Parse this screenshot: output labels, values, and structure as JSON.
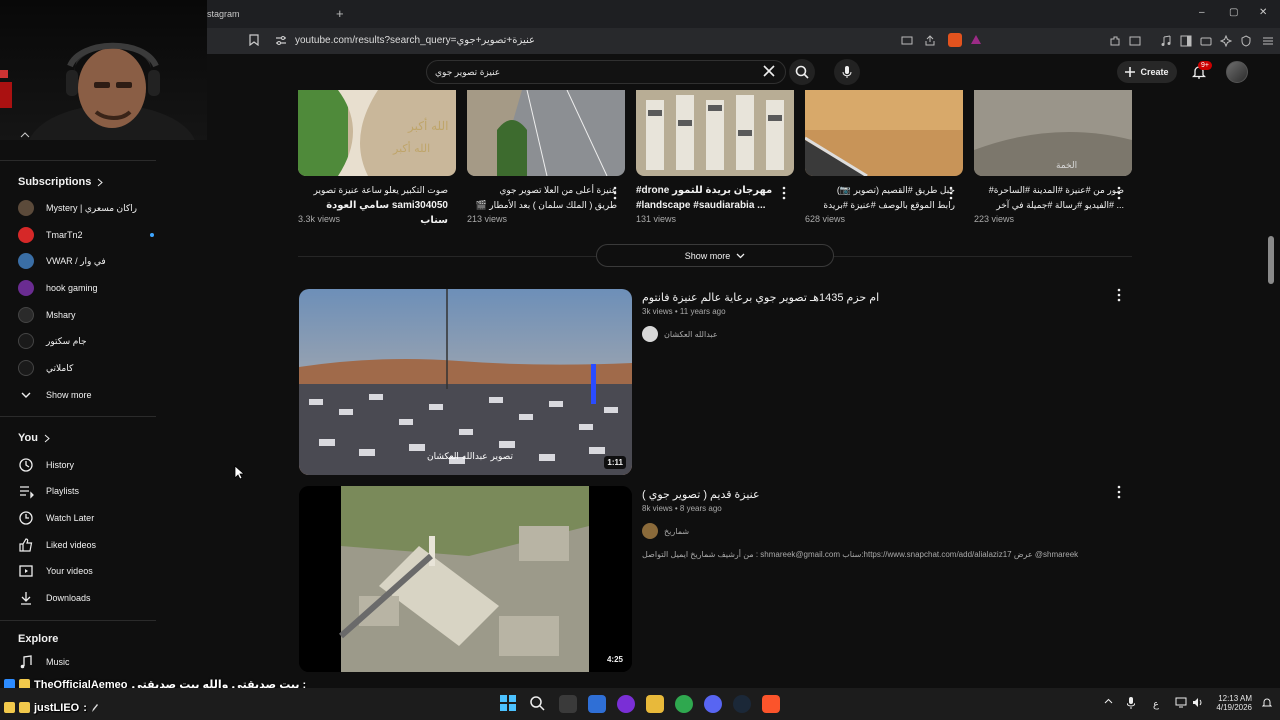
{
  "browser": {
    "tab_title": "stagram",
    "url": "youtube.com/results?search_query=عنيزة+تصوير+جوي",
    "window_controls": {
      "minimize": "–",
      "maximize": "▢",
      "close": "✕"
    }
  },
  "header": {
    "search_value": "عنيزة تصوير جوي",
    "create_label": "Create",
    "notification_count": "9+"
  },
  "sidebar": {
    "subscriptions_heading": "Subscriptions",
    "subscriptions": [
      {
        "label": "Mystery | راكان مسعري",
        "color": "#5b4a3a"
      },
      {
        "label": "TmarTn2",
        "color": "#d62828",
        "live": true
      },
      {
        "label": "VWAR / في وار",
        "color": "#3a6ea5"
      },
      {
        "label": "hook gaming",
        "color": "#6a2c91"
      },
      {
        "label": "Mshary",
        "color": "#2a2a2a"
      },
      {
        "label": "جام سكتور",
        "color": "#1a1a1a"
      },
      {
        "label": "كاملاتي",
        "color": "#1a1a1a"
      }
    ],
    "show_more": "Show more",
    "you_heading": "You",
    "you_items": [
      {
        "label": "History",
        "icon": "history-icon"
      },
      {
        "label": "Playlists",
        "icon": "playlists-icon"
      },
      {
        "label": "Watch Later",
        "icon": "watch-later-icon"
      },
      {
        "label": "Liked videos",
        "icon": "like-icon"
      },
      {
        "label": "Your videos",
        "icon": "your-videos-icon"
      },
      {
        "label": "Downloads",
        "icon": "download-icon"
      }
    ],
    "explore_heading": "Explore",
    "explore_items": [
      {
        "label": "Music",
        "icon": "music-icon"
      }
    ]
  },
  "shorts": [
    {
      "title_line1": "صوت التكبير يعلو ساعة عنيزة تصوير",
      "title_line2": "sami304050 سامي العودة سناب",
      "views": "3.3k views"
    },
    {
      "title_line1": "عنيزة أعلى من العلا تصوير جوي",
      "title_line2": "طريق ( الملك سلمان ) بعد الأمطار 🎬",
      "views": "213 views"
    },
    {
      "title_line1": "#drone مهرجان بريدة للتمور",
      "title_line2": "#landscape #saudiarabia ...",
      "views": "131 views",
      "ltr": true
    },
    {
      "title_line1": "جبل طريق #القصيم (تصوير 📷)",
      "title_line2": "رابط الموقع بالوصف #عنيزة #بريدة",
      "views": "628 views"
    },
    {
      "title_line1": "صور من #عنيزة #المدينة #الساحرة#",
      "title_line2": "... #الفيديو #رسالة #جميلة في آخر",
      "views": "223 views"
    }
  ],
  "show_more_label": "Show more",
  "results": [
    {
      "title": "ام حزم 1435هـ تصوير جوي برعاية عالم عنيزة فانتوم",
      "meta": "3k views • 11 years ago",
      "channel": "عبدالله العكشان",
      "duration": "1:11",
      "watermark": "تصوير عبدالله العكشان"
    },
    {
      "title": "عنيزة قديم ( تصوير جوي )",
      "meta": "8k views • 8 years ago",
      "channel": "شماريخ",
      "duration": "4:25",
      "description": "من أرشيف شماريخ ايميل التواصل : shmareek@gmail.com سناب:https://www.snapchat.com/add/alialaziz17 عرض @shmareek"
    }
  ],
  "chat": [
    {
      "user": "TheOfficialAemeo",
      "message": "بيت صديقتي والله بيت صديقتي :"
    },
    {
      "user": "justLIEO",
      "message": ":"
    }
  ],
  "taskbar": {
    "time": "12:13 AM",
    "date": "4/19/2026",
    "lang": "ع"
  }
}
